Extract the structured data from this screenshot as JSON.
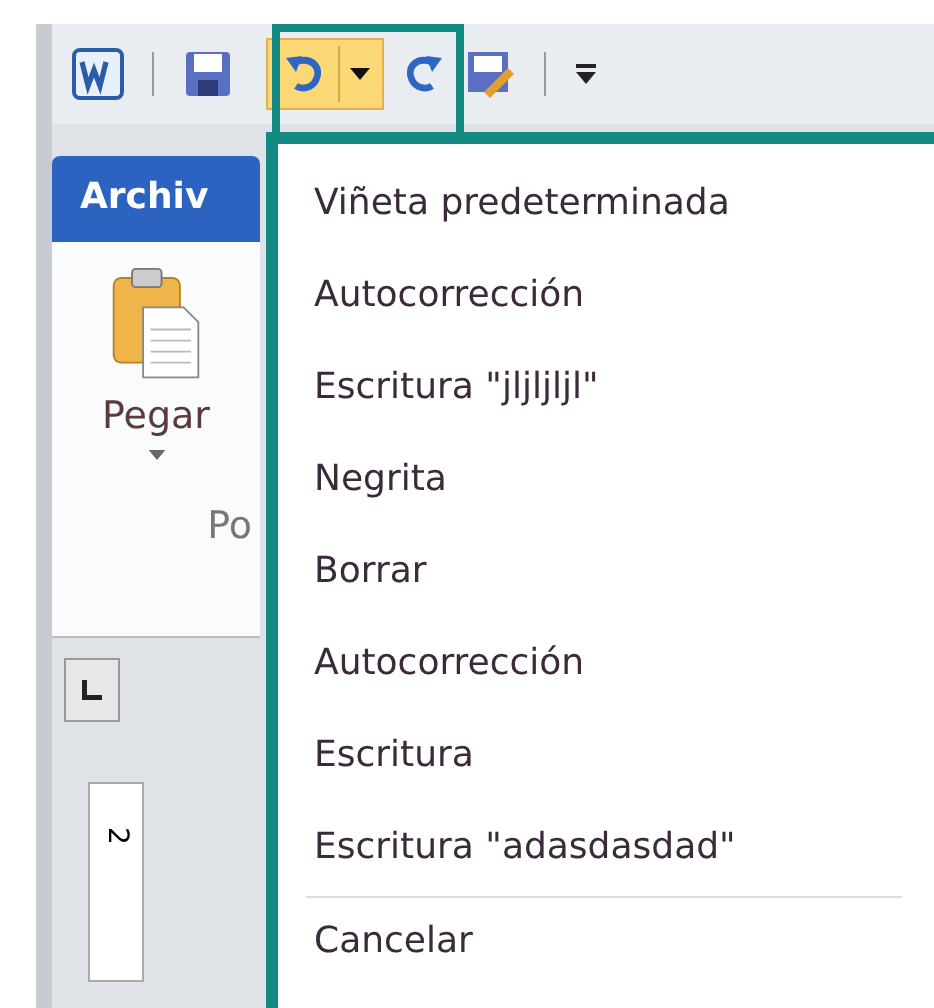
{
  "toolbar": [
    {
      "kind": "word"
    },
    {
      "kind": "separator"
    },
    {
      "kind": "save"
    },
    {
      "kind": "undo",
      "highlighted": true
    },
    {
      "kind": "redo"
    },
    {
      "kind": "edit"
    },
    {
      "kind": "separator"
    },
    {
      "kind": "customize"
    }
  ],
  "ribbon": {
    "tab": "Archiv",
    "paste_label": "Pegar",
    "group_label": "Po"
  },
  "ruler": {
    "label": "2"
  },
  "undo_menu": {
    "items": [
      "Viñeta predeterminada",
      "Autocorrección",
      "Escritura \"jljljljl\"",
      "Negrita",
      "Borrar",
      "Autocorrección",
      "Escritura",
      "Escritura \"adasdasdad\""
    ],
    "cancel": "Cancelar"
  }
}
